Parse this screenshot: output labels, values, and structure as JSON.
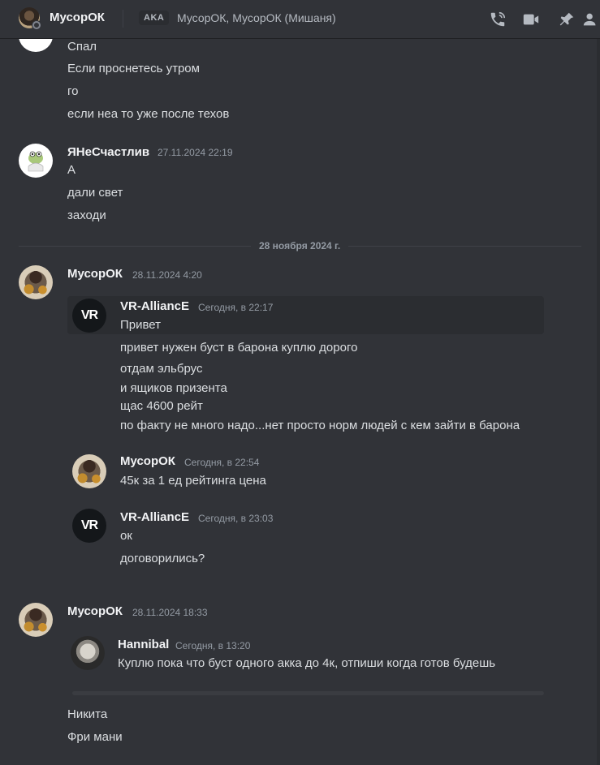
{
  "header": {
    "username": "МусорОК",
    "aka_label": "AKA",
    "aka_names": "МусорОК, МусорОК (Мишаня)",
    "icons": [
      "phone-call-icon",
      "video-camera-icon",
      "pin-icon",
      "add-friend-icon"
    ]
  },
  "messages": {
    "first_block": {
      "lines": [
        "Спал",
        "Если проснетесь утром",
        "го",
        "если неа то уже после техов"
      ]
    },
    "msg2": {
      "author": "ЯНеСчастлив",
      "timestamp": "27.11.2024 22:19",
      "lines": [
        "А",
        "дали свет",
        "заходи"
      ]
    },
    "date_separator": "28 ноября 2024 г.",
    "msg3": {
      "author": "МусорОК",
      "timestamp": "28.11.2024 4:20",
      "forwarded": [
        {
          "author": "VR-AlliancE",
          "timestamp": "Сегодня, в 22:17",
          "lines": [
            "Привет",
            "привет нужен буст в барона куплю дорого",
            "отдам эльбрус",
            "и ящиков призента",
            "щас 4600 рейт",
            "по факту не много надо...нет просто норм людей с кем зайти в барона"
          ]
        },
        {
          "author": "МусорОК",
          "timestamp": "Сегодня, в 22:54",
          "lines": [
            "45к за 1 ед рейтинга цена"
          ]
        },
        {
          "author": "VR-AlliancE",
          "timestamp": "Сегодня, в 23:03",
          "lines": [
            "ок",
            "договорились?"
          ]
        }
      ]
    },
    "msg4": {
      "author": "МусорОК",
      "timestamp": "28.11.2024 18:33",
      "forwarded": {
        "author": "Hannibal",
        "timestamp": "Сегодня, в 13:20",
        "text": "Куплю пока что буст одного акка до 4к, отпиши когда готов будешь"
      },
      "lines": [
        "Никита",
        "Фри мани"
      ]
    }
  },
  "avatars": {
    "vr_initials": "VR"
  },
  "colors": {
    "background": "#313338",
    "text": "#dbdee1",
    "author": "#f2f3f5",
    "muted": "#949ba4"
  }
}
